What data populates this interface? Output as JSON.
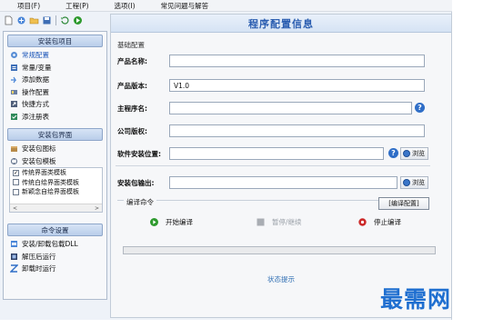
{
  "menu": [
    {
      "label": "项目(F)"
    },
    {
      "label": "工程(P)"
    },
    {
      "label": "选项(I)"
    },
    {
      "label": "常见问题与解答"
    }
  ],
  "toolbar": {
    "icons": [
      "new-file-icon",
      "open-icon",
      "open-folder-icon",
      "save-icon",
      "refresh-icon",
      "run-icon"
    ]
  },
  "sidebar": {
    "project_group": "安装包项目",
    "project_items": [
      {
        "label": "常规配置",
        "icon": "config-icon",
        "active": true
      },
      {
        "label": "常量/变量",
        "icon": "variables-icon"
      },
      {
        "label": "添加数据",
        "icon": "add-data-icon"
      },
      {
        "label": "操作配置",
        "icon": "operation-icon"
      },
      {
        "label": "快捷方式",
        "icon": "shortcut-icon"
      },
      {
        "label": "添注册表",
        "icon": "registry-icon"
      }
    ],
    "ui_group": "安装包界面",
    "ui_items": [
      {
        "label": "安装包图标",
        "icon": "package-icon"
      },
      {
        "label": "安装包模板",
        "icon": "template-icon"
      }
    ],
    "templates": [
      {
        "label": "传统界面类模板",
        "checked": true
      },
      {
        "label": "传统白绘界面类模板",
        "checked": false
      },
      {
        "label": "新颖念自绘界面模板",
        "checked": false
      }
    ],
    "scroll_left": "<",
    "scroll_right": ">",
    "cmd_group": "命令设置",
    "cmd_items": [
      {
        "label": "安装/卸载包载DLL",
        "icon": "dll-icon"
      },
      {
        "label": "解压后运行",
        "icon": "run-after-icon"
      },
      {
        "label": "卸载时运行",
        "icon": "uninstall-run-icon"
      }
    ]
  },
  "main": {
    "title": "程序配置信息",
    "basic_section": "基础配置",
    "fields": {
      "product_name": {
        "label": "产品名称:",
        "value": ""
      },
      "product_version": {
        "label": "产品版本:",
        "value": "V1.0"
      },
      "main_exe": {
        "label": "主程序名:",
        "value": ""
      },
      "copyright": {
        "label": "公司版权:",
        "value": ""
      },
      "install_path": {
        "label": "软件安装位置:",
        "value": ""
      },
      "output": {
        "label": "安装包输出:",
        "value": ""
      }
    },
    "browse_label": "浏览",
    "help_glyph": "?",
    "compile_section": "编译命令",
    "config_button": "[编译配置]",
    "actions": {
      "start": "开始编译",
      "pause": "暂停/继续",
      "stop": "停止编译"
    },
    "progress": 0,
    "status": "状态提示"
  },
  "watermark": "最需网",
  "colors": {
    "accent": "#2a5db0",
    "start": "#2e9a2e",
    "stop": "#cc2a2a",
    "progress_fill": "#6fbf5a"
  }
}
